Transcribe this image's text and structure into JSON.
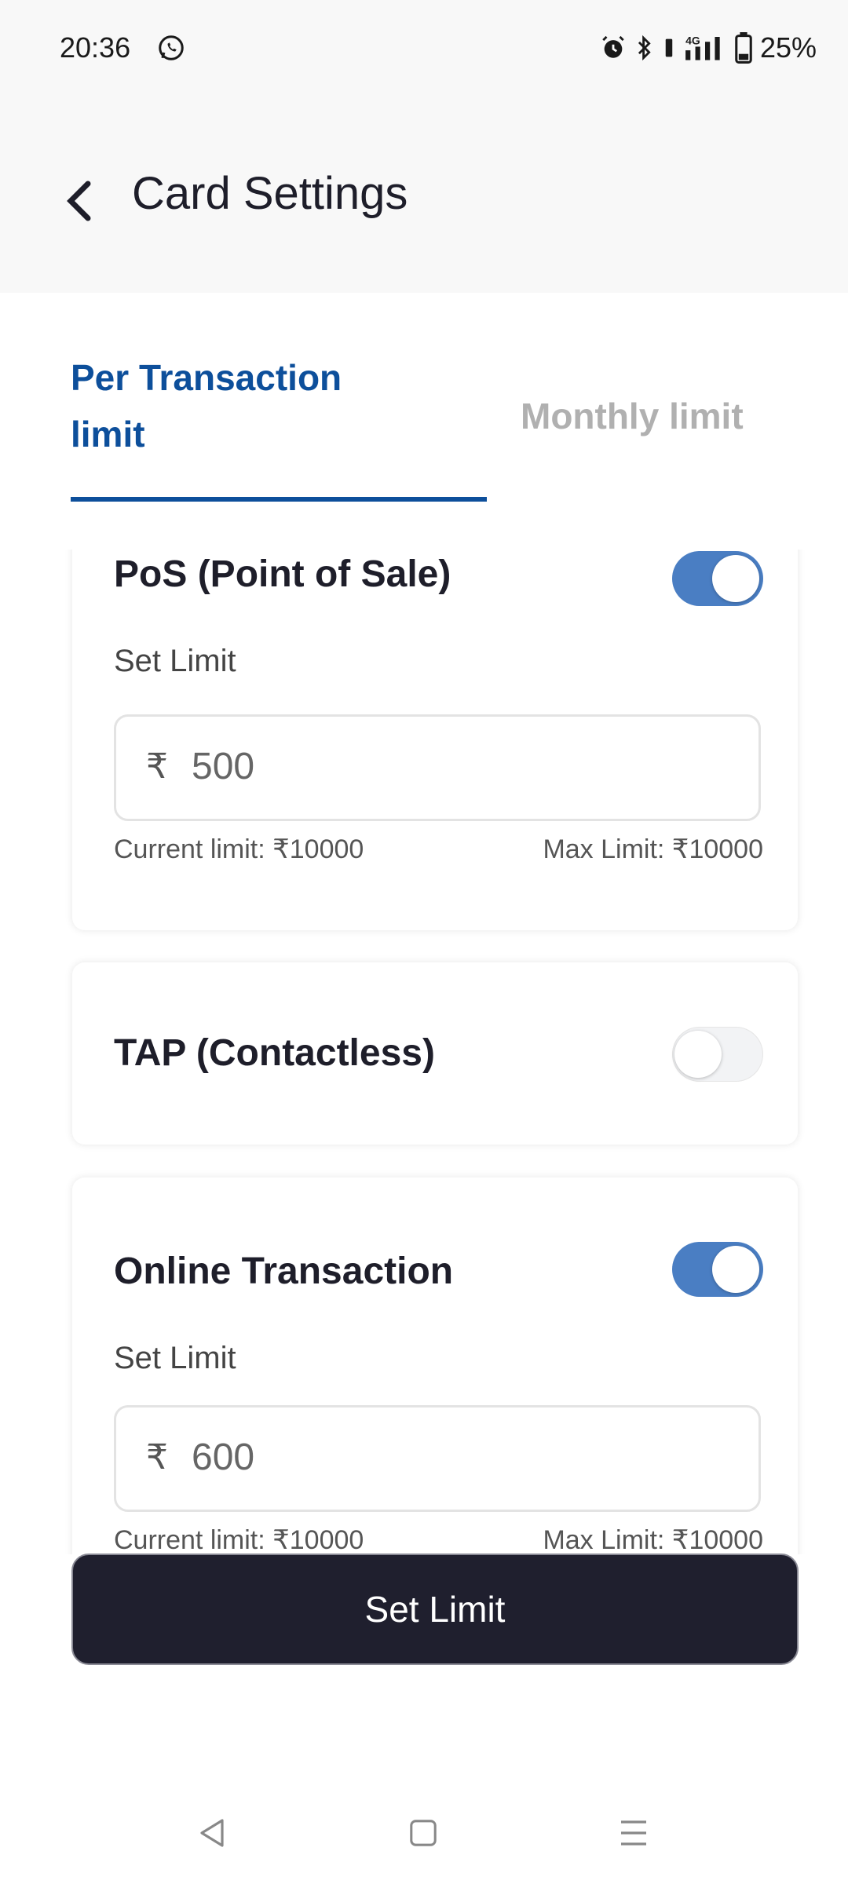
{
  "status_bar": {
    "time": "20:36",
    "battery": "25%"
  },
  "header": {
    "title": "Card Settings"
  },
  "tabs": [
    {
      "label": "Per Transaction limit",
      "active": true
    },
    {
      "label": "Monthly limit",
      "active": false
    }
  ],
  "cards": {
    "pos": {
      "title": "PoS (Point of Sale)",
      "enabled": true,
      "set_limit_label": "Set Limit",
      "currency_symbol": "₹",
      "amount": "500",
      "current_limit": "Current limit: ₹10000",
      "max_limit": "Max Limit: ₹10000"
    },
    "tap": {
      "title": "TAP (Contactless)",
      "enabled": false
    },
    "online": {
      "title": "Online Transaction",
      "enabled": true,
      "set_limit_label": "Set Limit",
      "currency_symbol": "₹",
      "amount": "600",
      "current_limit": "Current limit: ₹10000",
      "max_limit": "Max Limit: ₹10000"
    }
  },
  "actions": {
    "set_limit_label": "Set Limit"
  },
  "colors": {
    "primary": "#0d4f9b",
    "toggle_on": "#4a7ec3",
    "button_bg": "#1f1f2e"
  }
}
